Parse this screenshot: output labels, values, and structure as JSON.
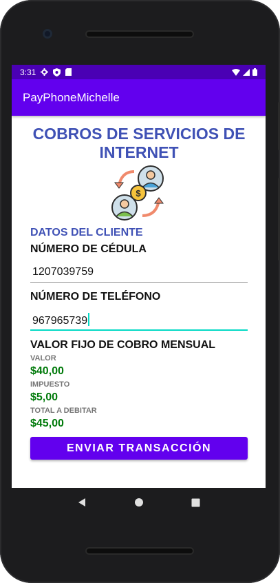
{
  "status_bar": {
    "time": "3:31",
    "colors": {
      "background": "#4a00b4"
    }
  },
  "app_bar": {
    "title": "PayPhoneMichelle",
    "color": "#6200ee"
  },
  "main": {
    "title": "COBROS DE SERVICIOS DE INTERNET",
    "illustration_icon": "money-transfer-users-icon",
    "client_section_title": "DATOS DEL CLIENTE",
    "id_label": "NÚMERO DE CÉDULA",
    "id_value": "1207039759",
    "phone_label": "NÚMERO DE TELÉFONO",
    "phone_value": "967965739",
    "fee_title": "VALOR FIJO DE COBRO MENSUAL",
    "value_label": "VALOR",
    "value_amount": "$40,00",
    "tax_label": "IMPUESTO",
    "tax_amount": "$5,00",
    "total_label": "TOTAL A DEBITAR",
    "total_amount": "$45,00",
    "send_button": "ENVIAR TRANSACCIÓN"
  },
  "colors": {
    "accent": "#6200ee",
    "title_blue": "#3f51b5",
    "money_green": "#007a0a",
    "focus_teal": "#03dac5"
  }
}
